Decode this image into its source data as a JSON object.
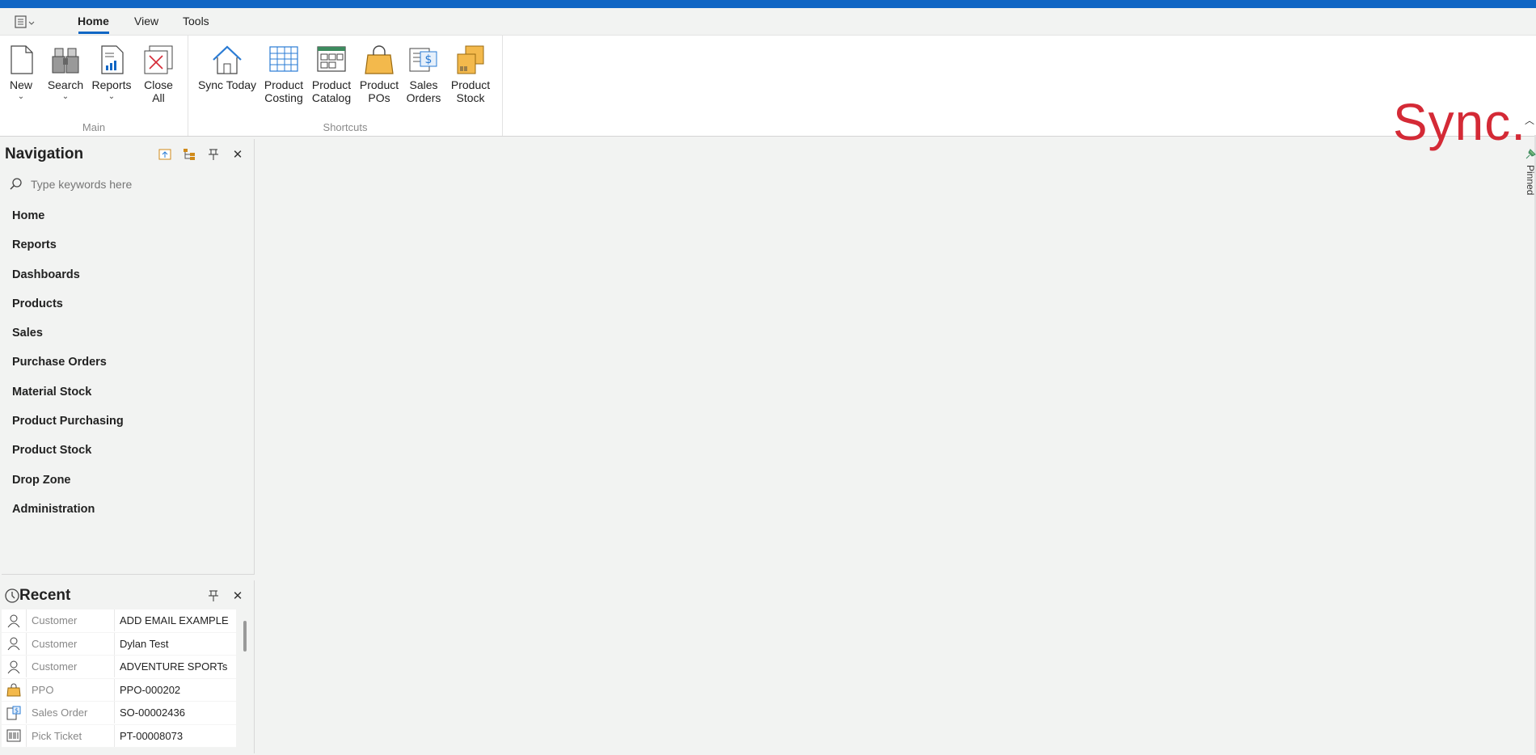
{
  "tabs": {
    "home": "Home",
    "view": "View",
    "tools": "Tools"
  },
  "ribbon": {
    "main": {
      "label": "Main",
      "new": "New",
      "search": "Search",
      "reports": "Reports",
      "close_all_1": "Close",
      "close_all_2": "All"
    },
    "shortcuts": {
      "label": "Shortcuts",
      "sync_today": "Sync Today",
      "product_costing_1": "Product",
      "product_costing_2": "Costing",
      "product_catalog_1": "Product",
      "product_catalog_2": "Catalog",
      "product_pos_1": "Product",
      "product_pos_2": "POs",
      "sales_orders_1": "Sales",
      "sales_orders_2": "Orders",
      "product_stock_1": "Product",
      "product_stock_2": "Stock"
    }
  },
  "logo": "Sync.",
  "navigation": {
    "title": "Navigation",
    "search_placeholder": "Type keywords here",
    "items": [
      "Home",
      "Reports",
      "Dashboards",
      "Products",
      "Sales",
      "Purchase Orders",
      "Material Stock",
      "Product Purchasing",
      "Product Stock",
      "Drop Zone",
      "Administration"
    ]
  },
  "recent": {
    "title": "Recent",
    "rows": [
      {
        "icon": "customer-icon",
        "type": "Customer",
        "value": "ADD EMAIL EXAMPLE"
      },
      {
        "icon": "customer-icon",
        "type": "Customer",
        "value": "Dylan Test"
      },
      {
        "icon": "customer-icon",
        "type": "Customer",
        "value": "ADVENTURE SPORTs"
      },
      {
        "icon": "ppo-bag-icon",
        "type": "PPO",
        "value": "PPO-000202"
      },
      {
        "icon": "sales-order-icon",
        "type": "Sales Order",
        "value": "SO-00002436"
      },
      {
        "icon": "pick-ticket-icon",
        "type": "Pick Ticket",
        "value": "PT-00008073"
      }
    ]
  },
  "pinned": {
    "label": "Pinned"
  },
  "colors": {
    "accent": "#1066c4",
    "logo": "#d42a36"
  }
}
